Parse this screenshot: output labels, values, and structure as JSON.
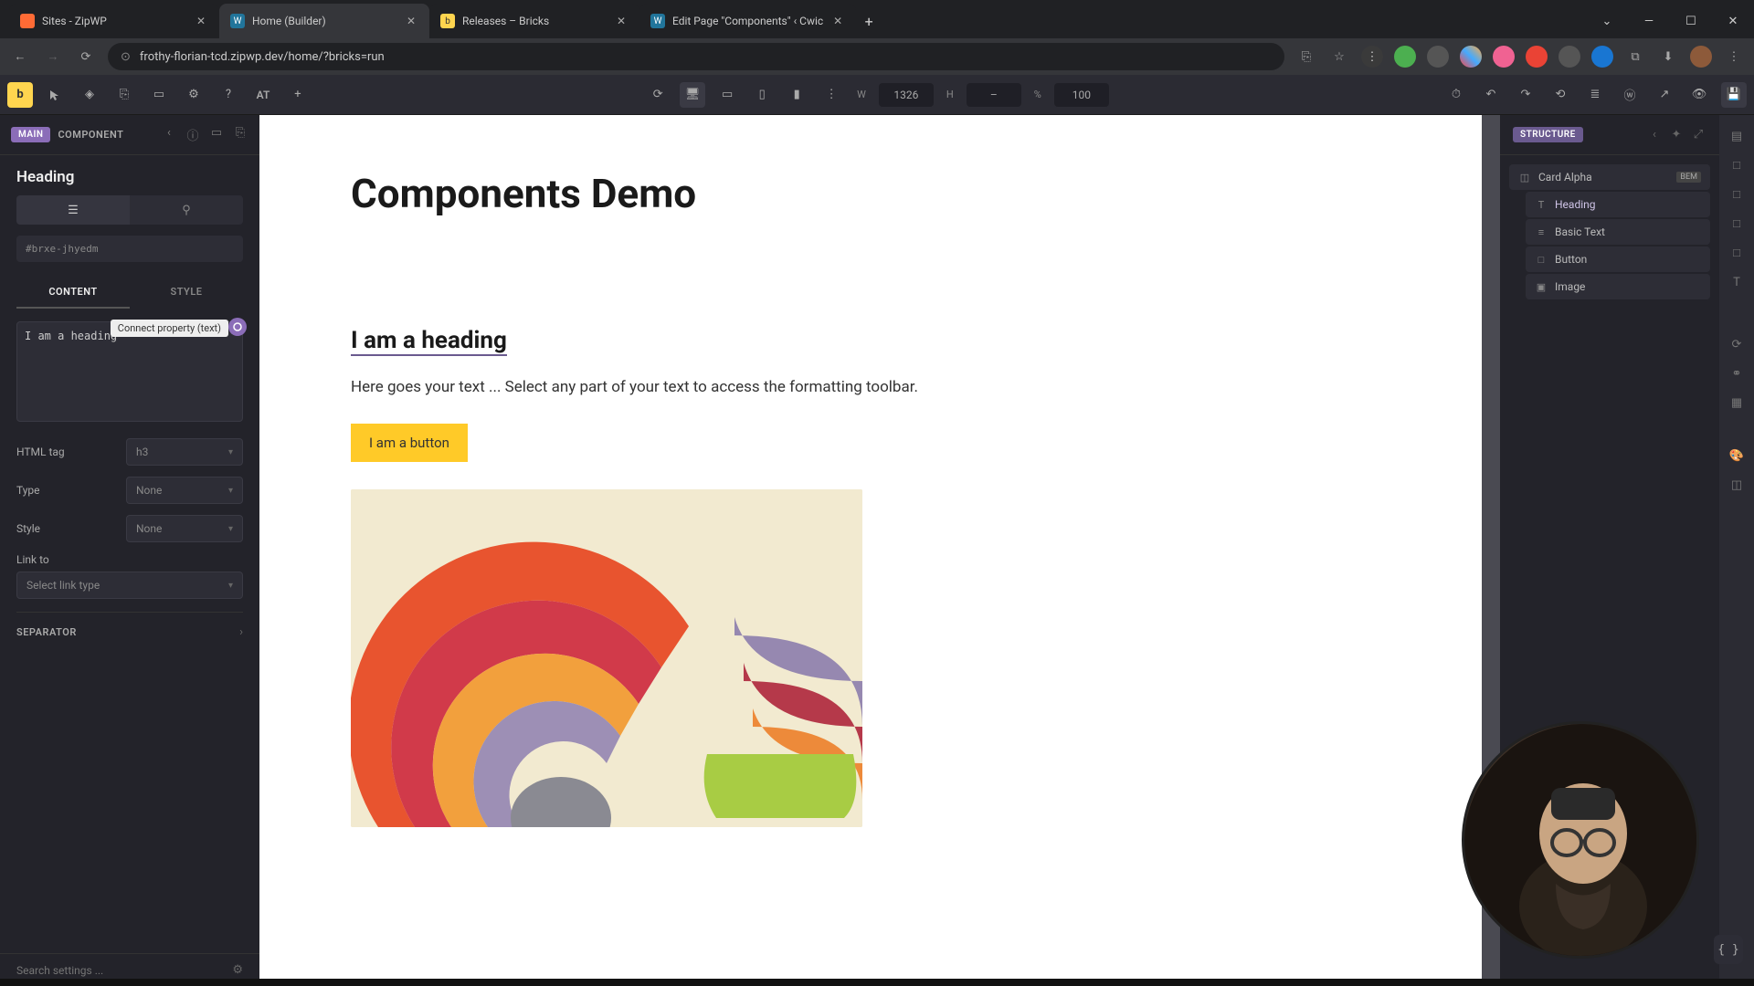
{
  "browser": {
    "tabs": [
      {
        "title": "Sites - ZipWP",
        "fav_bg": "#ff6b35"
      },
      {
        "title": "Home (Builder)",
        "fav_bg": "#3b5998"
      },
      {
        "title": "Releases – Bricks",
        "fav_bg": "#ffd54f"
      },
      {
        "title": "Edit Page \"Components\" ‹ Cwic",
        "fav_bg": "#3b5998"
      }
    ],
    "url": "frothy-florian-tcd.zipwp.dev/home/?bricks=run"
  },
  "toolbar": {
    "at_label": "AT",
    "width": "1326",
    "height": "–",
    "zoom": "100",
    "w_label": "W",
    "h_label": "H",
    "pct_label": "%"
  },
  "left_panel": {
    "main_badge": "MAIN",
    "component_label": "COMPONENT",
    "element_title": "Heading",
    "id_value": "#brxe-jhyedm",
    "content_tab": "CONTENT",
    "style_tab": "STYLE",
    "text_value": "I am a heading",
    "tooltip": "Connect property (text)",
    "html_tag_label": "HTML tag",
    "html_tag_value": "h3",
    "type_label": "Type",
    "type_value": "None",
    "style_label": "Style",
    "style_value": "None",
    "link_to_label": "Link to",
    "link_to_value": "Select link type",
    "separator_label": "SEPARATOR",
    "search_placeholder": "Search settings ..."
  },
  "canvas": {
    "page_title": "Components Demo",
    "heading": "I am a heading",
    "body_text": "Here goes your text ... Select any part of your text to access the formatting toolbar.",
    "button": "I am a button"
  },
  "structure": {
    "badge": "STRUCTURE",
    "root": "Card Alpha",
    "bem": "BEM",
    "items": [
      {
        "label": "Heading",
        "icon": "T"
      },
      {
        "label": "Basic Text",
        "icon": "≡"
      },
      {
        "label": "Button",
        "icon": "□"
      },
      {
        "label": "Image",
        "icon": "▣"
      }
    ]
  },
  "code_button": "{ }"
}
